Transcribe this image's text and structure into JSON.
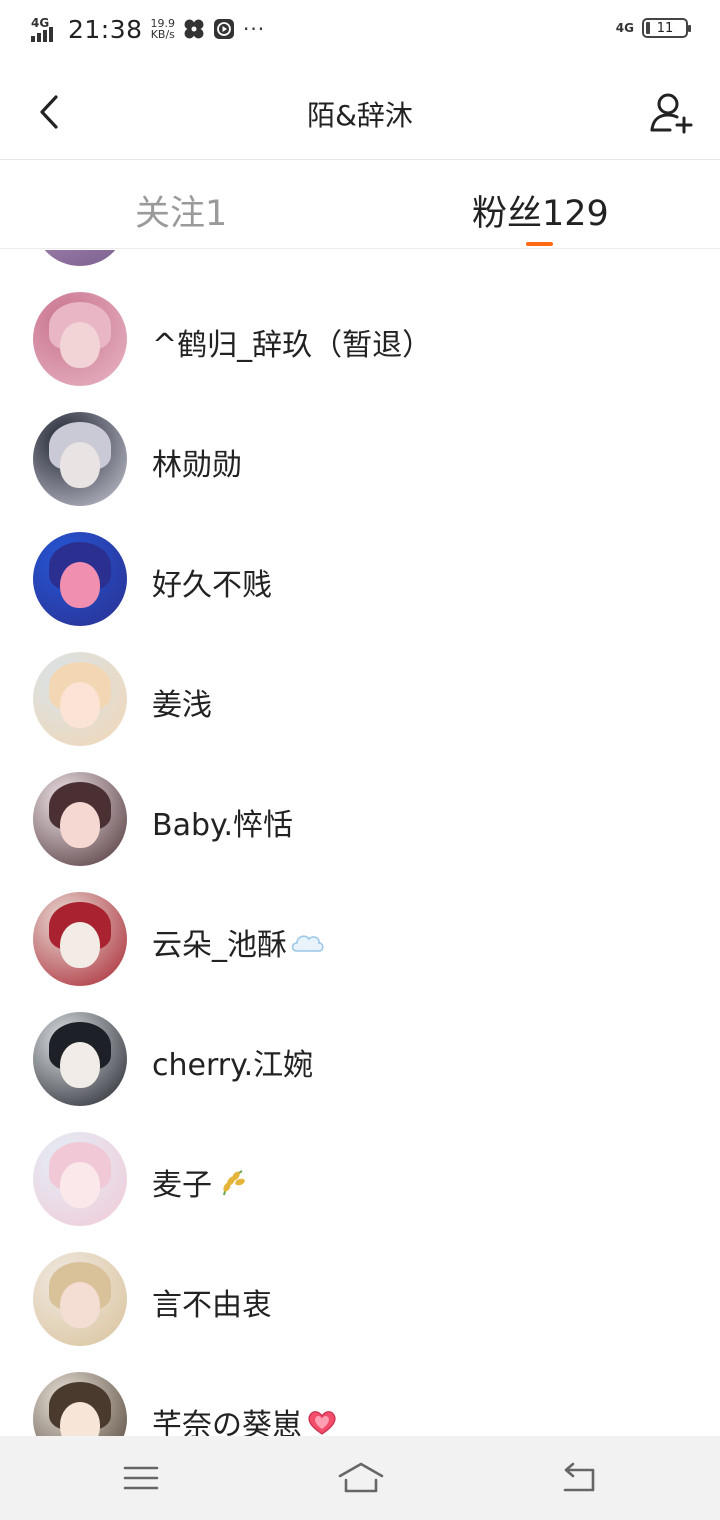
{
  "status_bar": {
    "network_left": "4G",
    "time": "21:38",
    "speed_value": "19.9",
    "speed_unit": "KB/s",
    "more": "···",
    "network_right": "4G",
    "battery": "11"
  },
  "header": {
    "title": "陌&辞沐",
    "back_icon": "chevron-left-icon",
    "add_user_icon": "add-user-icon"
  },
  "tabs": {
    "following": "关注1",
    "fans": "粉丝129",
    "active": "fans",
    "indicator_color": "#ff6a13"
  },
  "followers": [
    {
      "name": "^鹤归_辞玖（暂退）",
      "emoji": "",
      "colors": [
        "#c9738f",
        "#e8b6c4",
        "#f2d3d6"
      ]
    },
    {
      "name": "林勋勋",
      "emoji": "",
      "colors": [
        "#1f2330",
        "#c9cad6",
        "#e9e3e3"
      ]
    },
    {
      "name": "好久不贱",
      "emoji": "",
      "colors": [
        "#2557d6",
        "#2b2f8f",
        "#f08fb0"
      ]
    },
    {
      "name": "姜浅",
      "emoji": "",
      "colors": [
        "#d7e3ea",
        "#f3d6b3",
        "#fbe4d5"
      ]
    },
    {
      "name": "Baby.悴恬",
      "emoji": "",
      "colors": [
        "#f1e6ea",
        "#4a3033",
        "#f6d8d2"
      ]
    },
    {
      "name": "云朵_池酥",
      "emoji": "cloud",
      "colors": [
        "#e8ddd6",
        "#a8232f",
        "#f3ece6"
      ]
    },
    {
      "name": "cherry.江婉",
      "emoji": "",
      "colors": [
        "#dfe3e6",
        "#1e2028",
        "#f1ece8"
      ]
    },
    {
      "name": "麦子",
      "emoji": "rice",
      "colors": [
        "#e3eef8",
        "#f1c9d6",
        "#fbe8ea"
      ]
    },
    {
      "name": "言不由衷",
      "emoji": "",
      "colors": [
        "#f0e9e2",
        "#d9c29a",
        "#f4ddd3"
      ]
    },
    {
      "name": "芊奈の葵崽",
      "emoji": "heart",
      "colors": [
        "#ece6dc",
        "#4a3a2e",
        "#f7e6d8"
      ]
    }
  ],
  "navbar": {
    "menu_icon": "menu-icon",
    "home_icon": "home-icon",
    "back_icon": "return-icon"
  }
}
